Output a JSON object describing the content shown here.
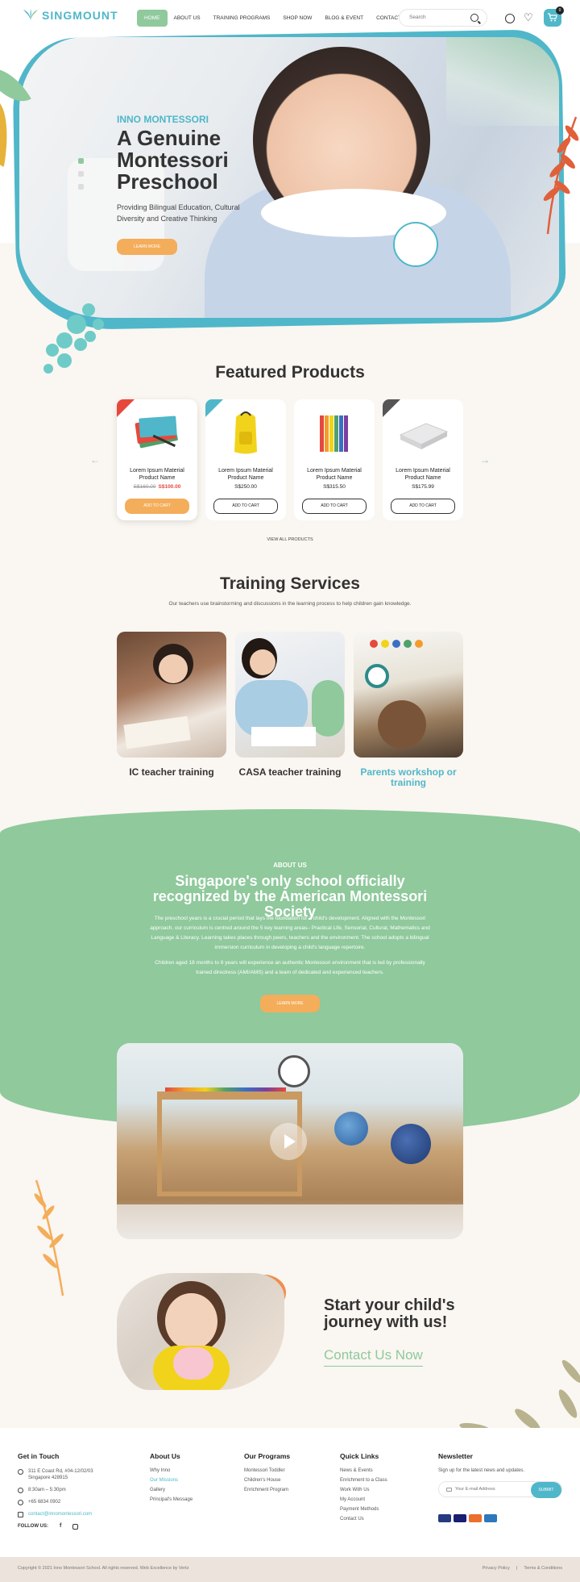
{
  "brand": {
    "name": "SINGMOUNT"
  },
  "nav": {
    "items": [
      "HOME",
      "ABOUT US",
      "TRAINING PROGRAMS",
      "SHOP NOW",
      "BLOG & EVENT",
      "CONTACT US"
    ],
    "search_placeholder": "Search",
    "cart_count": "0"
  },
  "hero": {
    "eyebrow": "INNO MONTESSORI",
    "title": "A Genuine Montessori Preschool",
    "subtitle": "Providing Bilingual Education, Cultural Diversity and Creative Thinking",
    "button": "LEARN MORE"
  },
  "featured": {
    "title": "Featured Products",
    "products": [
      {
        "name": "Lorem Ipsum Material Product Name",
        "old_price": "S$160.00",
        "price": "S$100.00",
        "button": "ADD TO CART"
      },
      {
        "name": "Lorem Ipsum Material Product Name",
        "old_price": "",
        "price": "S$250.00",
        "button": "ADD TO CART"
      },
      {
        "name": "Lorem Ipsum Material Product Name",
        "old_price": "",
        "price": "S$315.50",
        "button": "ADD TO CART"
      },
      {
        "name": "Lorem Ipsum Material Product Name",
        "old_price": "",
        "price": "S$175.99",
        "button": "ADD TO CART"
      }
    ],
    "view_all": "VIEW ALL PRODUCTS"
  },
  "training": {
    "title": "Training Services",
    "description": "Our teachers use brainstorming and discussions in the learning process to help children gain knowledge.",
    "items": [
      {
        "title": "IC teacher training"
      },
      {
        "title": "CASA teacher training"
      },
      {
        "title": "Parents workshop or training"
      }
    ]
  },
  "about": {
    "eyebrow": "ABOUT US",
    "title": "Singapore's only school officially recognized by the American Montessori Society",
    "p1": "The preschool years is a crucial period that lays the foundation for a child's development. Aligned with the Montessori approach, our curriculum is centred around the 5 key learning areas– Practical Life, Sensorial, Cultural, Mathematics and Language & Literacy. Learning takes places through peers, teachers and the environment. The school adopts a bilingual immersion curriculum in developing a child's language repertoire.",
    "p2": "Children aged 18 months to 6 years will experience an authentic Montessori environment that is led by professionally trained directress (AMI/AMS) and a team of dedicated and experienced teachers.",
    "button": "LEARN MORE"
  },
  "cta": {
    "title": "Start your child's journey with us!",
    "link": "Contact Us Now"
  },
  "footer": {
    "contact": {
      "heading": "Get in Touch",
      "address": "311 E Coast Rd, #04-12/02/03 Singapore 428915",
      "hours": "8:30am – 5:30pm",
      "phone": "+65 6834 0902",
      "email": "contact@innomontessori.com",
      "follow": "FOLLOW US:"
    },
    "about": {
      "heading": "About Us",
      "links": [
        "Why Inno",
        "Our Missions",
        "Gallery",
        "Principal's Message"
      ]
    },
    "programs": {
      "heading": "Our Programs",
      "links": [
        "Montessori Toddler",
        "Children's House",
        "Enrichment Program"
      ]
    },
    "quick": {
      "heading": "Quick Links",
      "links": [
        "News & Events",
        "Enrichment to a Class",
        "Work With Us",
        "My Account",
        "Payment Methods",
        "Contact Us"
      ]
    },
    "newsletter": {
      "heading": "Newsletter",
      "text": "Sign up for the latest news and updates.",
      "placeholder": "Your E-mail Address",
      "button": "SUBMIT"
    },
    "copyright": "Copyright © 2021 Inno Montessori School. All rights reserved. Web Excellence by Vertz",
    "privacy": "Privacy Policy",
    "terms": "Terms & Conditions"
  },
  "colors": {
    "teal": "#4fb7c9",
    "green": "#8fc99c",
    "orange": "#f4ad5a",
    "red": "#e6483c"
  }
}
